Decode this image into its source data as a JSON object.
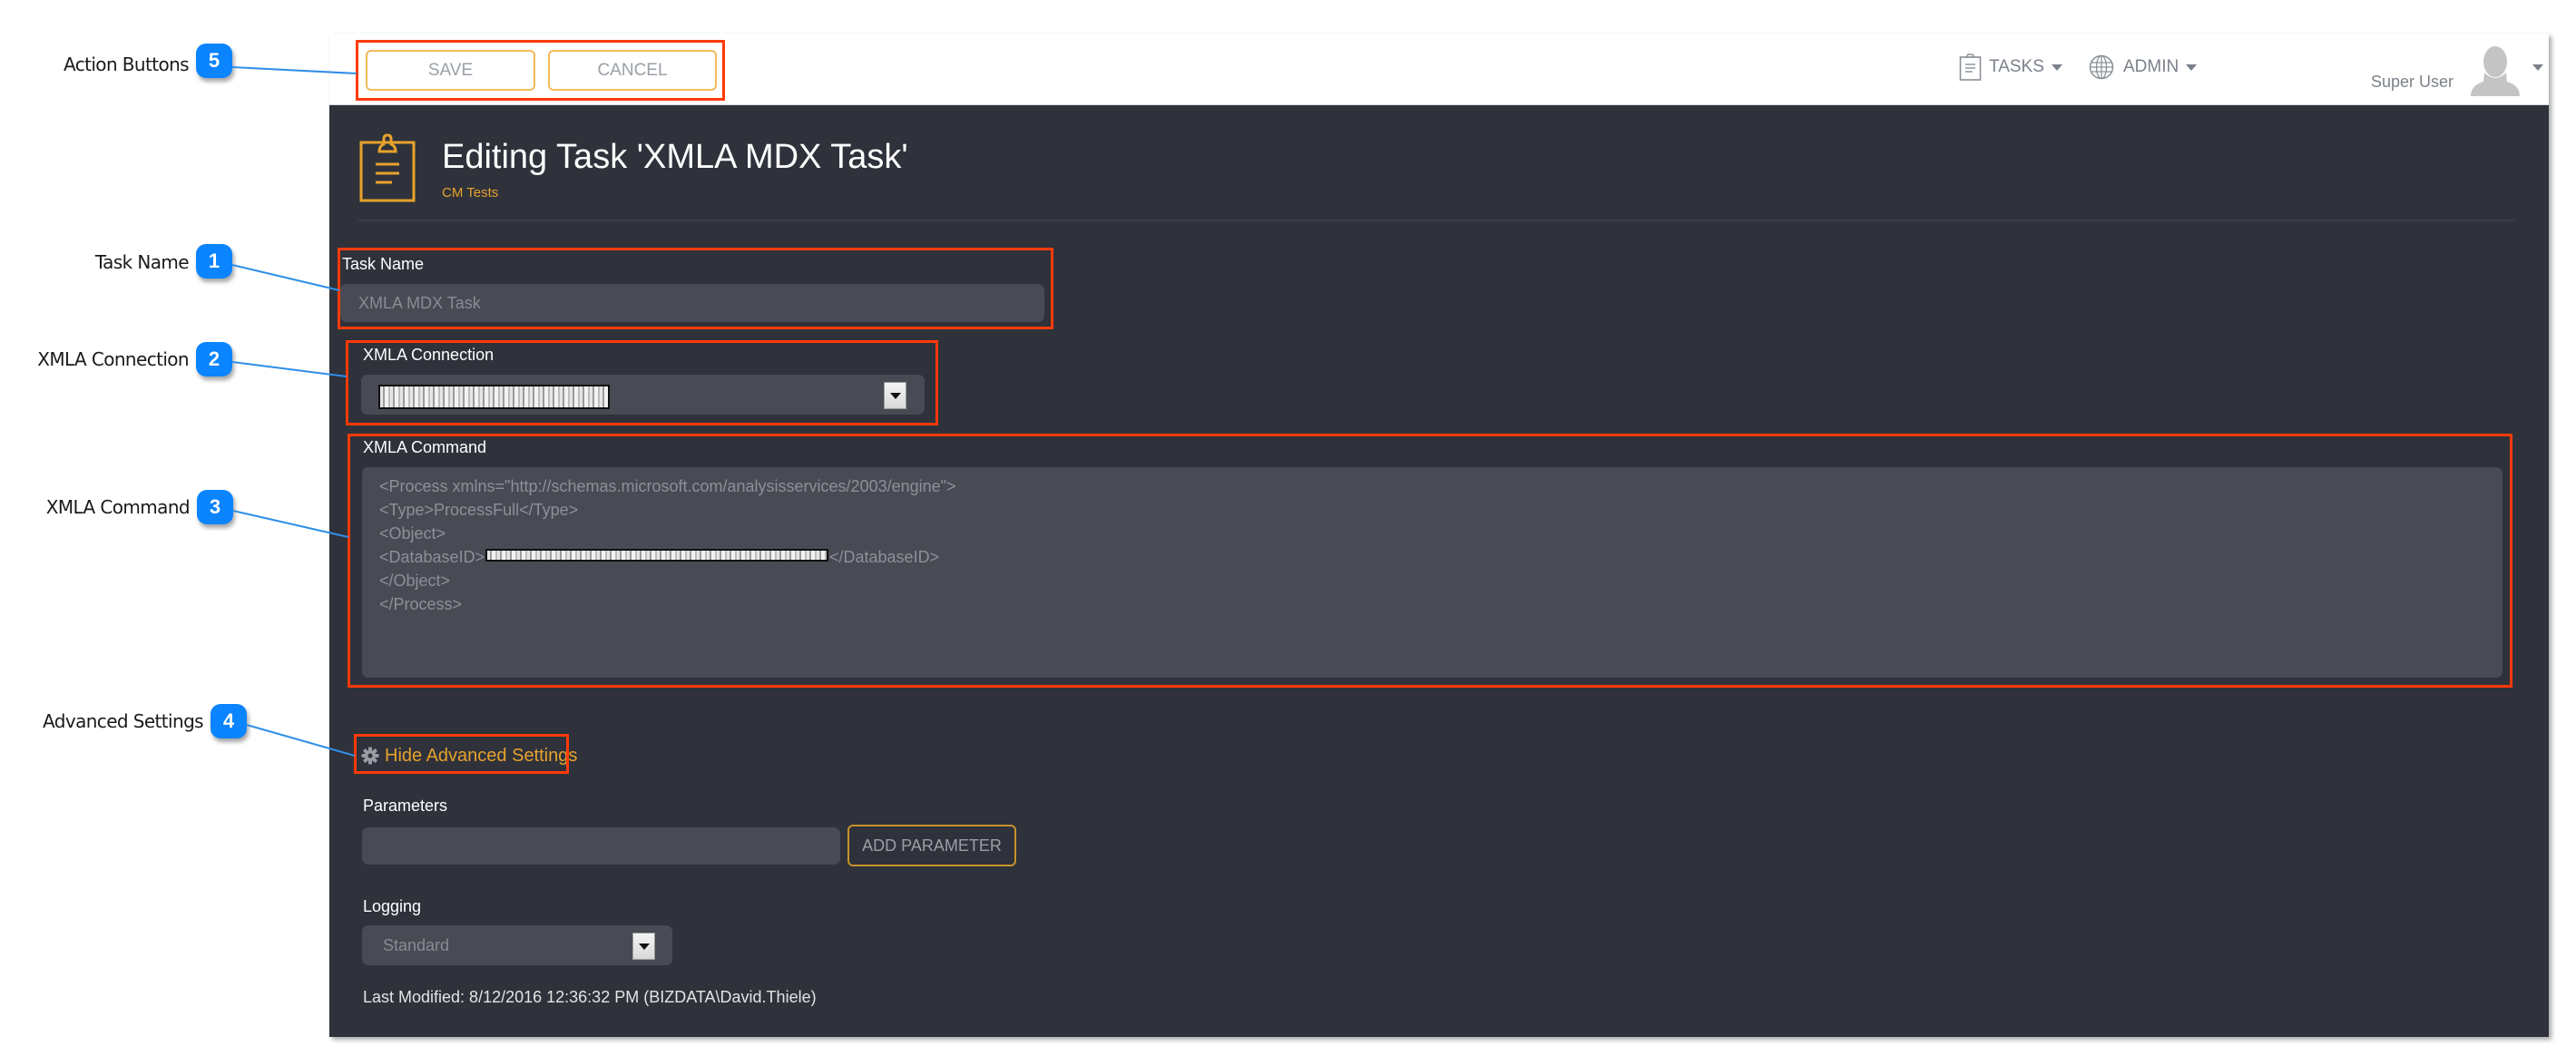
{
  "callouts": [
    {
      "number": "5",
      "label": "Action Buttons"
    },
    {
      "number": "1",
      "label": "Task Name"
    },
    {
      "number": "2",
      "label": "XMLA Connection"
    },
    {
      "number": "3",
      "label": "XMLA Command"
    },
    {
      "number": "4",
      "label": "Advanced Settings"
    }
  ],
  "toolbar": {
    "save_label": "SAVE",
    "cancel_label": "CANCEL"
  },
  "nav": {
    "tasks_label": "TASKS",
    "admin_label": "ADMIN",
    "user_name": "Super User"
  },
  "page": {
    "title": "Editing Task 'XMLA MDX Task'",
    "subtitle": "CM Tests",
    "icon": "clipboard-icon"
  },
  "form": {
    "task_name": {
      "label": "Task Name",
      "value": "XMLA MDX Task"
    },
    "xmla_connection": {
      "label": "XMLA Connection",
      "value": "[redacted]"
    },
    "xmla_command": {
      "label": "XMLA Command",
      "lines": [
        "<Process xmlns=\"http://schemas.microsoft.com/analysisservices/2003/engine\">",
        "<Type>ProcessFull</Type>",
        "<Object>",
        "<DatabaseID>",
        "</Object>",
        "</Process>"
      ],
      "database_id_close": "</DatabaseID>"
    },
    "advanced_toggle": "Hide Advanced Settings",
    "parameters": {
      "label": "Parameters",
      "value": "",
      "add_button": "ADD PARAMETER"
    },
    "logging": {
      "label": "Logging",
      "value": "Standard"
    },
    "last_modified": "Last Modified: 8/12/2016 12:36:32 PM (BIZDATA\\David.Thiele)"
  },
  "colors": {
    "accent": "#e7a22c",
    "panel_bg": "#2f323b",
    "input_bg": "#484b54",
    "annotation_red": "#ff3a0a",
    "callout_blue": "#0a84ff"
  }
}
